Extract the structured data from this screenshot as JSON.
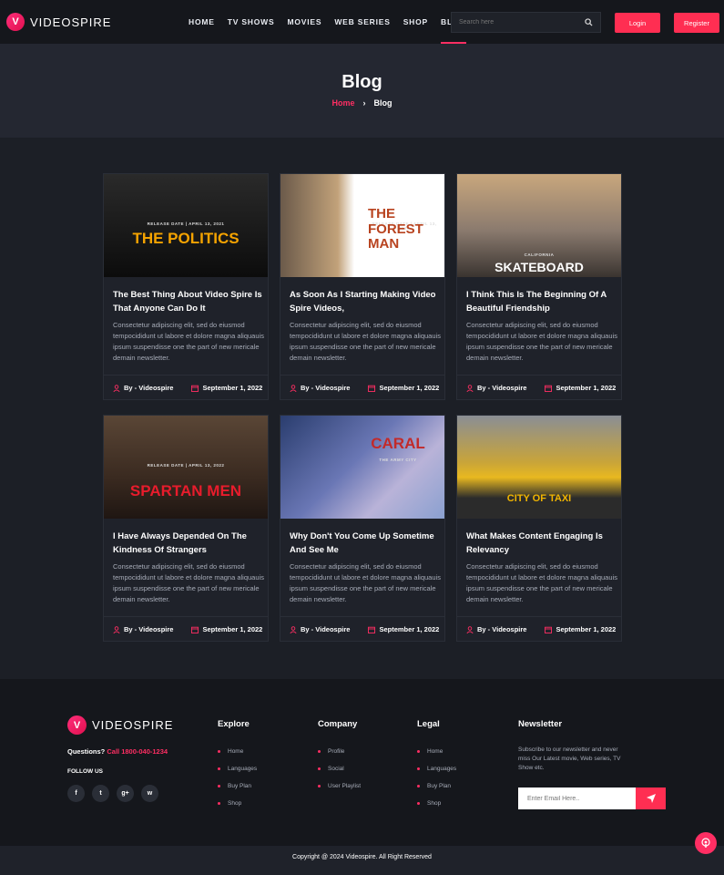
{
  "brand": {
    "name": "VIDEOSPIRE",
    "mark": "V"
  },
  "nav": [
    "HOME",
    "TV SHOWS",
    "MOVIES",
    "WEB SERIES",
    "SHOP",
    "BLOG"
  ],
  "search": {
    "placeholder": "Search here"
  },
  "auth": {
    "login": "Login",
    "register": "Register"
  },
  "hero": {
    "title": "Blog",
    "breadcrumb_home": "Home",
    "breadcrumb_current": "Blog"
  },
  "posts": [
    {
      "title": "The Best Thing About Video Spire Is That Anyone Can Do It",
      "excerpt": "Consectetur adipiscing elit, sed do eiusmod tempocididunt ut labore et dolore magna aliquauis ipsum suspendisse one the part of new mericale demain newsletter.",
      "author": "By - Videospire",
      "date": "September 1, 2022",
      "thumb_caption": "THE POLITICS",
      "thumb_sub": "RELEASE DATE | APRIL 13, 2021"
    },
    {
      "title": "As Soon As I Starting Making Video Spire Videos,",
      "excerpt": "Consectetur adipiscing elit, sed do eiusmod tempocididunt ut labore et dolore magna aliquauis ipsum suspendisse one the part of new mericale demain newsletter.",
      "author": "By - Videospire",
      "date": "September 1, 2022",
      "thumb_caption": "THE FOREST MAN",
      "thumb_sub": "RELEASE DATE | APRIL 13, 2022"
    },
    {
      "title": "I Think This Is The Beginning Of A Beautiful Friendship",
      "excerpt": "Consectetur adipiscing elit, sed do eiusmod tempocididunt ut labore et dolore magna aliquauis ipsum suspendisse one the part of new mericale demain newsletter.",
      "author": "By - Videospire",
      "date": "September 1, 2022",
      "thumb_caption": "SKATEBOARD",
      "thumb_sub": "CALIFORNIA"
    },
    {
      "title": "I Have Always Depended On The Kindness Of Strangers",
      "excerpt": "Consectetur adipiscing elit, sed do eiusmod tempocididunt ut labore et dolore magna aliquauis ipsum suspendisse one the part of new mericale demain newsletter.",
      "author": "By - Videospire",
      "date": "September 1, 2022",
      "thumb_caption": "SPARTAN MEN",
      "thumb_sub": "RELEASE DATE | APRIL 13, 2022"
    },
    {
      "title": "Why Don't You Come Up Sometime And See Me",
      "excerpt": "Consectetur adipiscing elit, sed do eiusmod tempocididunt ut labore et dolore magna aliquauis ipsum suspendisse one the part of new mericale demain newsletter.",
      "author": "By - Videospire",
      "date": "September 1, 2022",
      "thumb_caption": "CARAL",
      "thumb_sub": "THE ARMY CITY"
    },
    {
      "title": "What Makes Content Engaging Is Relevancy",
      "excerpt": "Consectetur adipiscing elit, sed do eiusmod tempocididunt ut labore et dolore magna aliquauis ipsum suspendisse one the part of new mericale demain newsletter.",
      "author": "By - Videospire",
      "date": "September 1, 2022",
      "thumb_caption": "CITY OF TAXI",
      "thumb_sub": ""
    }
  ],
  "footer": {
    "questions_label": "Questions?",
    "phone": "Call 1800-040-1234",
    "follow_label": "FOLLOW US",
    "social": [
      "f",
      "t",
      "g+",
      "w"
    ],
    "explore": {
      "title": "Explore",
      "links": [
        "Home",
        "Languages",
        "Buy Plan",
        "Shop"
      ]
    },
    "company": {
      "title": "Company",
      "links": [
        "Profile",
        "Social",
        "User Playlist"
      ]
    },
    "legal": {
      "title": "Legal",
      "links": [
        "Home",
        "Languages",
        "Buy Plan",
        "Shop"
      ]
    },
    "newsletter": {
      "title": "Newsletter",
      "text": "Subscribe to our newsletter and never miss Our Latest movie, Web series, TV Show etc.",
      "placeholder": "Enter Email Here.."
    },
    "copyright": "Copyright @ 2024 Videospire. All Right Reserved"
  },
  "colors": {
    "accent": "#ff2e63",
    "bg": "#1c1f26"
  }
}
